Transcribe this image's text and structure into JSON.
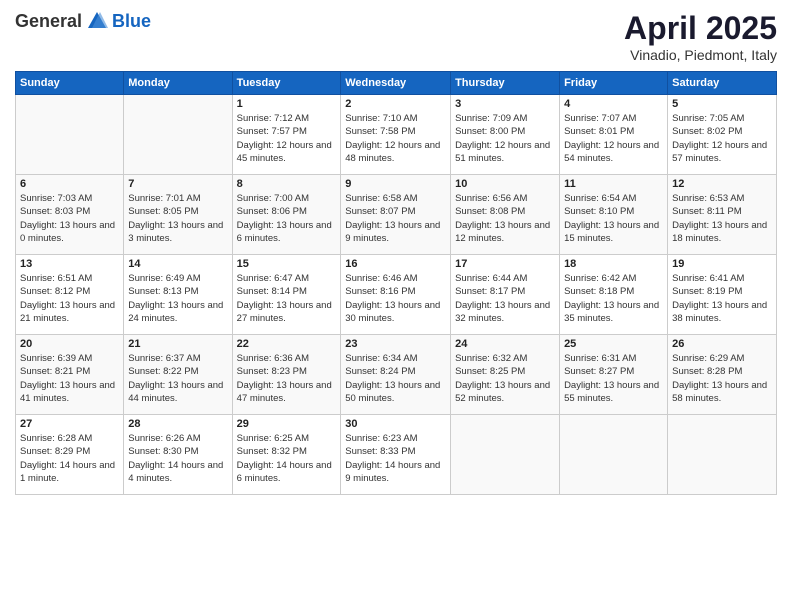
{
  "logo": {
    "general": "General",
    "blue": "Blue"
  },
  "header": {
    "month": "April 2025",
    "location": "Vinadio, Piedmont, Italy"
  },
  "weekdays": [
    "Sunday",
    "Monday",
    "Tuesday",
    "Wednesday",
    "Thursday",
    "Friday",
    "Saturday"
  ],
  "weeks": [
    [
      {
        "day": "",
        "info": ""
      },
      {
        "day": "",
        "info": ""
      },
      {
        "day": "1",
        "info": "Sunrise: 7:12 AM\nSunset: 7:57 PM\nDaylight: 12 hours and 45 minutes."
      },
      {
        "day": "2",
        "info": "Sunrise: 7:10 AM\nSunset: 7:58 PM\nDaylight: 12 hours and 48 minutes."
      },
      {
        "day": "3",
        "info": "Sunrise: 7:09 AM\nSunset: 8:00 PM\nDaylight: 12 hours and 51 minutes."
      },
      {
        "day": "4",
        "info": "Sunrise: 7:07 AM\nSunset: 8:01 PM\nDaylight: 12 hours and 54 minutes."
      },
      {
        "day": "5",
        "info": "Sunrise: 7:05 AM\nSunset: 8:02 PM\nDaylight: 12 hours and 57 minutes."
      }
    ],
    [
      {
        "day": "6",
        "info": "Sunrise: 7:03 AM\nSunset: 8:03 PM\nDaylight: 13 hours and 0 minutes."
      },
      {
        "day": "7",
        "info": "Sunrise: 7:01 AM\nSunset: 8:05 PM\nDaylight: 13 hours and 3 minutes."
      },
      {
        "day": "8",
        "info": "Sunrise: 7:00 AM\nSunset: 8:06 PM\nDaylight: 13 hours and 6 minutes."
      },
      {
        "day": "9",
        "info": "Sunrise: 6:58 AM\nSunset: 8:07 PM\nDaylight: 13 hours and 9 minutes."
      },
      {
        "day": "10",
        "info": "Sunrise: 6:56 AM\nSunset: 8:08 PM\nDaylight: 13 hours and 12 minutes."
      },
      {
        "day": "11",
        "info": "Sunrise: 6:54 AM\nSunset: 8:10 PM\nDaylight: 13 hours and 15 minutes."
      },
      {
        "day": "12",
        "info": "Sunrise: 6:53 AM\nSunset: 8:11 PM\nDaylight: 13 hours and 18 minutes."
      }
    ],
    [
      {
        "day": "13",
        "info": "Sunrise: 6:51 AM\nSunset: 8:12 PM\nDaylight: 13 hours and 21 minutes."
      },
      {
        "day": "14",
        "info": "Sunrise: 6:49 AM\nSunset: 8:13 PM\nDaylight: 13 hours and 24 minutes."
      },
      {
        "day": "15",
        "info": "Sunrise: 6:47 AM\nSunset: 8:14 PM\nDaylight: 13 hours and 27 minutes."
      },
      {
        "day": "16",
        "info": "Sunrise: 6:46 AM\nSunset: 8:16 PM\nDaylight: 13 hours and 30 minutes."
      },
      {
        "day": "17",
        "info": "Sunrise: 6:44 AM\nSunset: 8:17 PM\nDaylight: 13 hours and 32 minutes."
      },
      {
        "day": "18",
        "info": "Sunrise: 6:42 AM\nSunset: 8:18 PM\nDaylight: 13 hours and 35 minutes."
      },
      {
        "day": "19",
        "info": "Sunrise: 6:41 AM\nSunset: 8:19 PM\nDaylight: 13 hours and 38 minutes."
      }
    ],
    [
      {
        "day": "20",
        "info": "Sunrise: 6:39 AM\nSunset: 8:21 PM\nDaylight: 13 hours and 41 minutes."
      },
      {
        "day": "21",
        "info": "Sunrise: 6:37 AM\nSunset: 8:22 PM\nDaylight: 13 hours and 44 minutes."
      },
      {
        "day": "22",
        "info": "Sunrise: 6:36 AM\nSunset: 8:23 PM\nDaylight: 13 hours and 47 minutes."
      },
      {
        "day": "23",
        "info": "Sunrise: 6:34 AM\nSunset: 8:24 PM\nDaylight: 13 hours and 50 minutes."
      },
      {
        "day": "24",
        "info": "Sunrise: 6:32 AM\nSunset: 8:25 PM\nDaylight: 13 hours and 52 minutes."
      },
      {
        "day": "25",
        "info": "Sunrise: 6:31 AM\nSunset: 8:27 PM\nDaylight: 13 hours and 55 minutes."
      },
      {
        "day": "26",
        "info": "Sunrise: 6:29 AM\nSunset: 8:28 PM\nDaylight: 13 hours and 58 minutes."
      }
    ],
    [
      {
        "day": "27",
        "info": "Sunrise: 6:28 AM\nSunset: 8:29 PM\nDaylight: 14 hours and 1 minute."
      },
      {
        "day": "28",
        "info": "Sunrise: 6:26 AM\nSunset: 8:30 PM\nDaylight: 14 hours and 4 minutes."
      },
      {
        "day": "29",
        "info": "Sunrise: 6:25 AM\nSunset: 8:32 PM\nDaylight: 14 hours and 6 minutes."
      },
      {
        "day": "30",
        "info": "Sunrise: 6:23 AM\nSunset: 8:33 PM\nDaylight: 14 hours and 9 minutes."
      },
      {
        "day": "",
        "info": ""
      },
      {
        "day": "",
        "info": ""
      },
      {
        "day": "",
        "info": ""
      }
    ]
  ]
}
